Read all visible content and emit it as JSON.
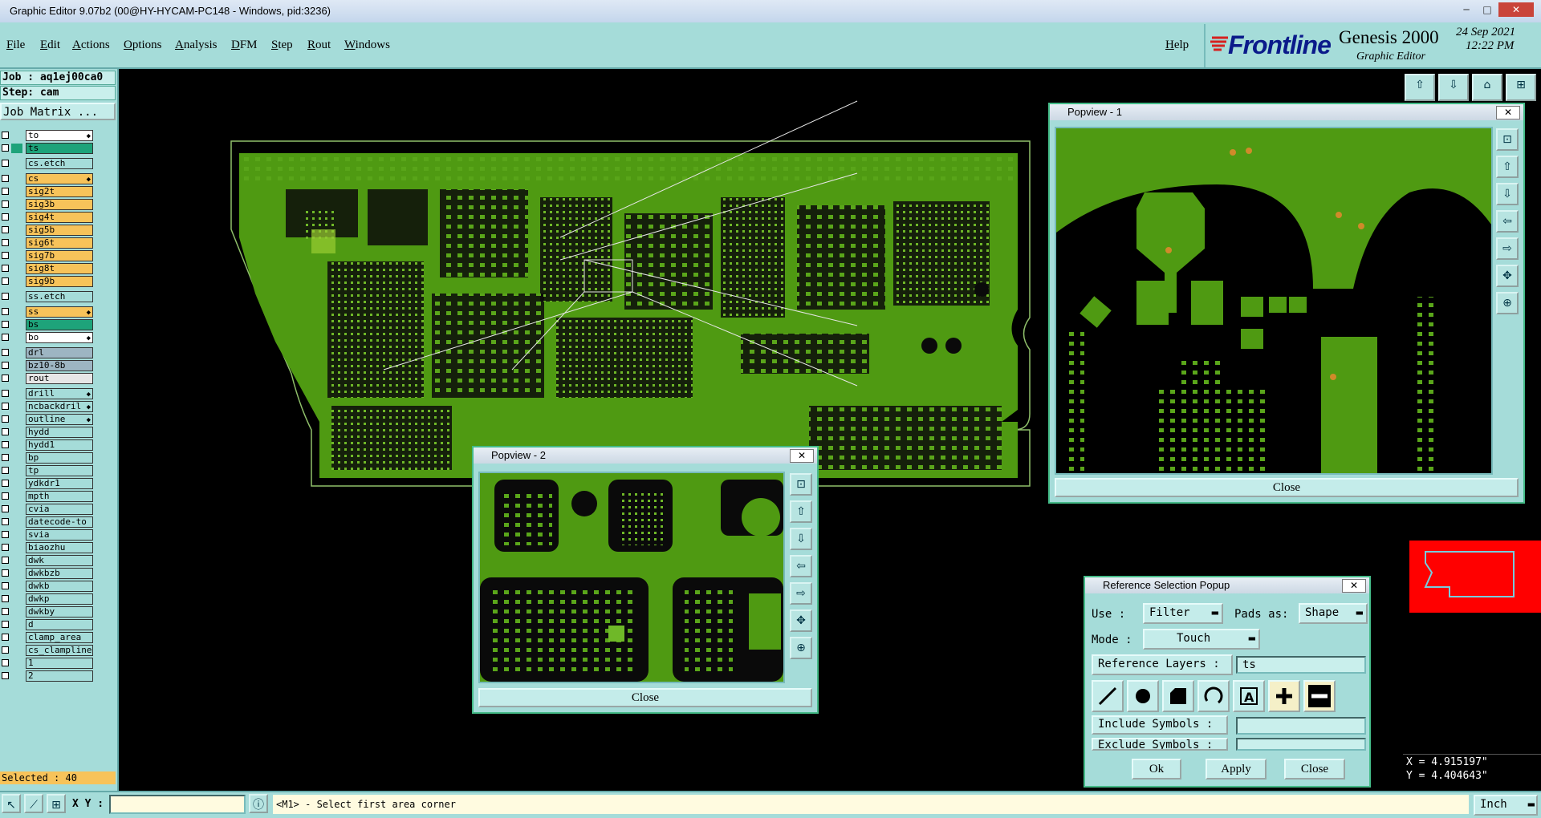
{
  "window": {
    "title": "Graphic Editor 9.07b2 (00@HY-HYCAM-PC148 - Windows, pid:3236)"
  },
  "menu": {
    "items": [
      "File",
      "Edit",
      "Actions",
      "Options",
      "Analysis",
      "DFM",
      "Step",
      "Rout",
      "Windows"
    ],
    "help": "Help"
  },
  "brand": {
    "logo": "Frontline",
    "product": "Genesis 2000",
    "subtitle": "Graphic Editor",
    "date": "24 Sep 2021",
    "time": "12:22 PM"
  },
  "job": {
    "job_line": "Job : aq1ej00ca0",
    "step_line": "Step: cam",
    "matrix_button": "Job Matrix ..."
  },
  "layers": [
    {
      "name": "to",
      "color": "#ffffff",
      "ind": "",
      "arrow": true
    },
    {
      "name": "ts",
      "color": "#1ea37a",
      "ind": "#1ea37a",
      "arrow": false
    },
    {
      "name": "cs.etch",
      "color": "#a5dcd9",
      "ind": "",
      "arrow": false,
      "gap": true
    },
    {
      "name": "cs",
      "color": "#f7c35a",
      "ind": "",
      "arrow": true,
      "gap": true
    },
    {
      "name": "sig2t",
      "color": "#f7c35a",
      "ind": "",
      "arrow": false
    },
    {
      "name": "sig3b",
      "color": "#f7c35a",
      "ind": "",
      "arrow": false
    },
    {
      "name": "sig4t",
      "color": "#f7c35a",
      "ind": "",
      "arrow": false
    },
    {
      "name": "sig5b",
      "color": "#f7c35a",
      "ind": "",
      "arrow": false
    },
    {
      "name": "sig6t",
      "color": "#f7c35a",
      "ind": "",
      "arrow": false
    },
    {
      "name": "sig7b",
      "color": "#f7c35a",
      "ind": "",
      "arrow": false
    },
    {
      "name": "sig8t",
      "color": "#f7c35a",
      "ind": "",
      "arrow": false
    },
    {
      "name": "sig9b",
      "color": "#f7c35a",
      "ind": "",
      "arrow": false
    },
    {
      "name": "ss.etch",
      "color": "#a5dcd9",
      "ind": "",
      "arrow": false,
      "gap": true
    },
    {
      "name": "ss",
      "color": "#f7c35a",
      "ind": "",
      "arrow": true,
      "gap": true
    },
    {
      "name": "bs",
      "color": "#1ea37a",
      "ind": "",
      "arrow": false
    },
    {
      "name": "bo",
      "color": "#ffffff",
      "ind": "",
      "arrow": true
    },
    {
      "name": "drl",
      "color": "#9db5c2",
      "ind": "",
      "arrow": false,
      "gap": true
    },
    {
      "name": "bz10-8b",
      "color": "#9db5c2",
      "ind": "",
      "arrow": false
    },
    {
      "name": "rout",
      "color": "#e6e6e6",
      "ind": "",
      "arrow": false
    },
    {
      "name": "drill",
      "color": "#a5dcd9",
      "ind": "",
      "arrow": true,
      "gap": true
    },
    {
      "name": "ncbackdril",
      "color": "#a5dcd9",
      "ind": "",
      "arrow": true
    },
    {
      "name": "outline",
      "color": "#a5dcd9",
      "ind": "",
      "arrow": true
    },
    {
      "name": "hydd",
      "color": "#a5dcd9",
      "ind": "",
      "arrow": false
    },
    {
      "name": "hydd1",
      "color": "#a5dcd9",
      "ind": "",
      "arrow": false
    },
    {
      "name": "bp",
      "color": "#a5dcd9",
      "ind": "",
      "arrow": false
    },
    {
      "name": "tp",
      "color": "#a5dcd9",
      "ind": "",
      "arrow": false
    },
    {
      "name": "ydkdr1",
      "color": "#a5dcd9",
      "ind": "",
      "arrow": false
    },
    {
      "name": "mpth",
      "color": "#a5dcd9",
      "ind": "",
      "arrow": false
    },
    {
      "name": "cvia",
      "color": "#a5dcd9",
      "ind": "",
      "arrow": false
    },
    {
      "name": "datecode-to",
      "color": "#a5dcd9",
      "ind": "",
      "arrow": false
    },
    {
      "name": "svia",
      "color": "#a5dcd9",
      "ind": "",
      "arrow": false
    },
    {
      "name": "biaozhu",
      "color": "#a5dcd9",
      "ind": "",
      "arrow": false
    },
    {
      "name": "dwk",
      "color": "#a5dcd9",
      "ind": "",
      "arrow": false
    },
    {
      "name": "dwkbzb",
      "color": "#a5dcd9",
      "ind": "",
      "arrow": false
    },
    {
      "name": "dwkb",
      "color": "#a5dcd9",
      "ind": "",
      "arrow": false
    },
    {
      "name": "dwkp",
      "color": "#a5dcd9",
      "ind": "",
      "arrow": false
    },
    {
      "name": "dwkby",
      "color": "#a5dcd9",
      "ind": "",
      "arrow": false
    },
    {
      "name": "d",
      "color": "#a5dcd9",
      "ind": "",
      "arrow": false
    },
    {
      "name": "clamp_area",
      "color": "#a5dcd9",
      "ind": "",
      "arrow": false
    },
    {
      "name": "cs_clampline",
      "color": "#a5dcd9",
      "ind": "",
      "arrow": false
    },
    {
      "name": "1",
      "color": "#a5dcd9",
      "ind": "",
      "arrow": false
    },
    {
      "name": "2",
      "color": "#a5dcd9",
      "ind": "",
      "arrow": false
    }
  ],
  "selected": "Selected : 40",
  "popview1": {
    "title": "Popview - 1",
    "close": "Close"
  },
  "popview2": {
    "title": "Popview - 2",
    "close": "Close"
  },
  "refpopup": {
    "title": "Reference Selection Popup",
    "use_label": "Use  :",
    "use_value": "Filter",
    "pads_label": "Pads as:",
    "pads_value": "Shape",
    "mode_label": "Mode :",
    "mode_value": "Touch",
    "ref_layers_label": "Reference Layers :",
    "ref_layers_value": "ts",
    "include_label": "Include Symbols :",
    "exclude_label": "Exclude Symbols :",
    "ok": "Ok",
    "apply": "Apply",
    "close": "Close"
  },
  "coords": {
    "x": "X = 4.915197\"",
    "y": "Y = 4.404643\""
  },
  "status": {
    "xy_label": "X Y :",
    "message": "<M1> - Select first area corner",
    "units": "Inch"
  },
  "colors": {
    "panel": "#a5dcd9",
    "pcb_green": "#4f9a12",
    "layer_orange": "#f7c35a",
    "layer_teal": "#1ea37a"
  }
}
